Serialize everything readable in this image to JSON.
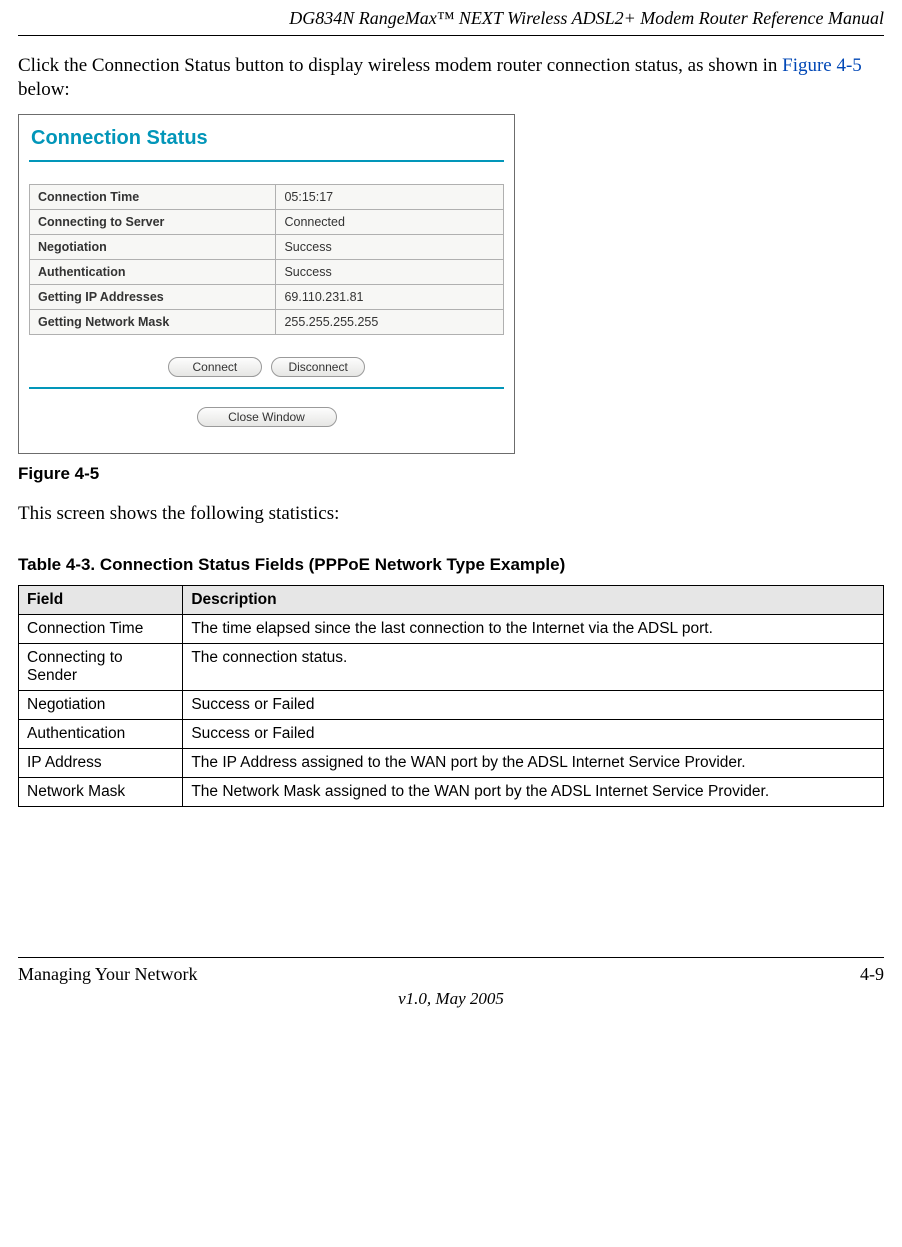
{
  "header": {
    "title": "DG834N RangeMax™ NEXT Wireless ADSL2+ Modem Router Reference Manual"
  },
  "intro": {
    "pre": "Click the Connection Status button to display wireless modem router connection status, as shown in ",
    "figref": "Figure 4-5",
    "post": " below:"
  },
  "screenshot": {
    "title": "Connection Status",
    "rows": [
      {
        "label": "Connection Time",
        "value": "05:15:17"
      },
      {
        "label": "Connecting to Server",
        "value": "Connected"
      },
      {
        "label": "Negotiation",
        "value": "Success"
      },
      {
        "label": "Authentication",
        "value": "Success"
      },
      {
        "label": "Getting IP Addresses",
        "value": "69.110.231.81"
      },
      {
        "label": "Getting Network Mask",
        "value": "255.255.255.255"
      }
    ],
    "buttons": {
      "connect": "Connect",
      "disconnect": "Disconnect",
      "close": "Close Window"
    }
  },
  "fig_caption": "Figure 4-5",
  "after_fig": "This screen shows the following statistics:",
  "table": {
    "caption": "Table 4-3. Connection Status Fields (PPPoE Network Type Example)",
    "headers": {
      "field": "Field",
      "description": "Description"
    },
    "rows": [
      {
        "field": "Connection Time",
        "description": "The time elapsed since the last connection to the Internet via the ADSL port."
      },
      {
        "field": "Connecting to Sender",
        "description": "The connection status."
      },
      {
        "field": "Negotiation",
        "description": "Success or Failed"
      },
      {
        "field": "Authentication",
        "description": "Success or Failed"
      },
      {
        "field": "IP Address",
        "description": "The IP Address assigned to the WAN port by the ADSL Internet Service Provider."
      },
      {
        "field": "Network Mask",
        "description": "The Network Mask assigned to the WAN port by the ADSL Internet Service Provider."
      }
    ]
  },
  "footer": {
    "left": "Managing Your Network",
    "right": "4-9",
    "center": "v1.0, May 2005"
  }
}
